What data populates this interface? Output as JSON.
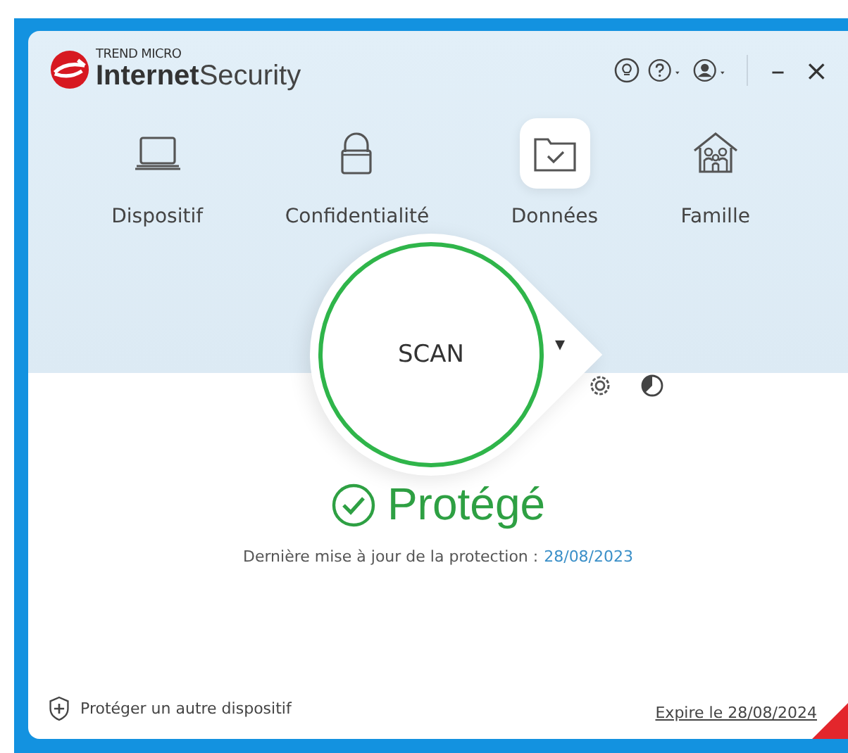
{
  "brand": {
    "company": "TREND MICRO",
    "product_bold": "Internet",
    "product_light": "Security"
  },
  "window_controls": {
    "minimize": "–",
    "close": "×"
  },
  "nav": [
    {
      "label": "Dispositif",
      "kind": "laptop",
      "selected": false
    },
    {
      "label": "Confidentialité",
      "kind": "lock",
      "selected": false
    },
    {
      "label": "Données",
      "kind": "folder",
      "selected": true
    },
    {
      "label": "Famille",
      "kind": "family",
      "selected": false
    }
  ],
  "scan": {
    "label": "SCAN",
    "dropdown": "▾"
  },
  "status": {
    "label": "Protégé",
    "protected": true,
    "update_text": "Dernière mise à jour de la protection :",
    "update_date": "28/08/2023"
  },
  "footer": {
    "protect_link": "Protéger un autre dispositif",
    "expiry": "Expire le 28/08/2024"
  }
}
